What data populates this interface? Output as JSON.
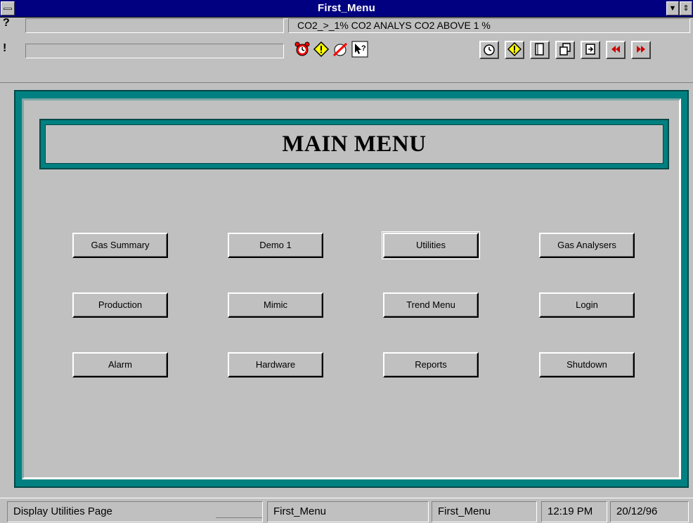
{
  "window": {
    "title": "First_Menu"
  },
  "header": {
    "help_symbol": "?",
    "alert_symbol": "!",
    "alarm_text": "CO2_>_1%  CO2 ANALYS CO2 ABOVE 1 %",
    "field1_value": "",
    "field2_value": ""
  },
  "mini_icons": [
    "alarm-clock-icon",
    "warning-diamond-icon",
    "disable-alarm-icon",
    "help-pointer-icon"
  ],
  "toolbar": [
    {
      "name": "alarm-summary-icon",
      "glyph": "⏰"
    },
    {
      "name": "warning-icon",
      "glyph": "!"
    },
    {
      "name": "page-icon",
      "glyph": "▯"
    },
    {
      "name": "copy-pages-icon",
      "glyph": "❐"
    },
    {
      "name": "exit-page-icon",
      "glyph": "⇥"
    },
    {
      "name": "previous-page-icon",
      "glyph": "◀◀"
    },
    {
      "name": "next-page-icon",
      "glyph": "▶▶"
    }
  ],
  "main": {
    "heading": "MAIN  MENU",
    "buttons": [
      [
        "Gas Summary",
        "Demo 1",
        "Utilities",
        "Gas Analysers"
      ],
      [
        "Production",
        "Mimic",
        "Trend Menu",
        "Login"
      ],
      [
        "Alarm",
        "Hardware",
        "Reports",
        "Shutdown"
      ]
    ]
  },
  "status": {
    "message": "Display Utilities Page",
    "display1": "First_Menu",
    "display2": "First_Menu",
    "time": "12:19 PM",
    "date": "20/12/96"
  },
  "colors": {
    "titlebar": "#000080",
    "frame_teal": "#008080",
    "face": "#c0c0c0",
    "toolbar_red": "#cc0000",
    "warning_yellow": "#ffff00"
  }
}
